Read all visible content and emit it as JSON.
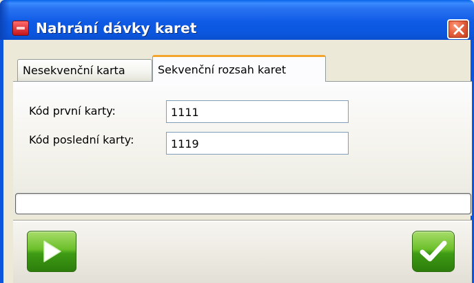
{
  "window": {
    "title": "Nahrání dávky karet"
  },
  "tabs": [
    {
      "label": "Nesekvenční karta",
      "active": false
    },
    {
      "label": "Sekvenční rozsah karet",
      "active": true
    }
  ],
  "form": {
    "first_card_label": "Kód první karty:",
    "first_card_value": "1111",
    "last_card_label": "Kód poslední karty:",
    "last_card_value": "1119"
  },
  "progress": {
    "value": 0
  },
  "icons": {
    "app": "app-card-icon",
    "close": "close-icon",
    "start": "play-icon",
    "confirm": "checkmark-icon"
  },
  "colors": {
    "titlebar": "#0b56dd",
    "close_button": "#e5603e",
    "active_tab_accent": "#f3a42a",
    "button_green": "#4ca81b"
  }
}
